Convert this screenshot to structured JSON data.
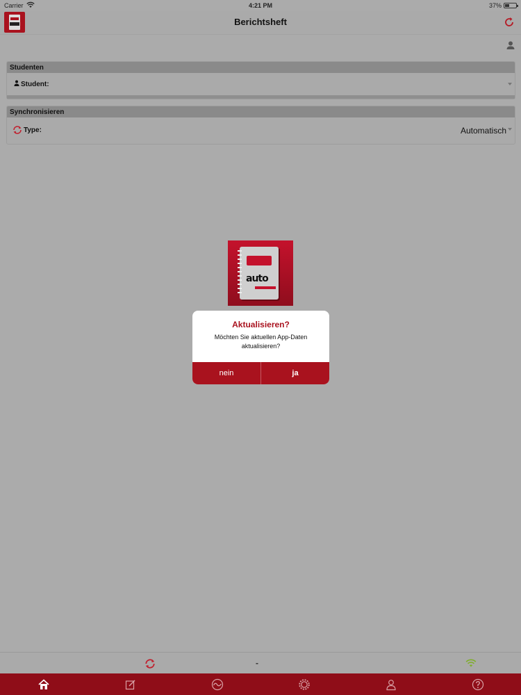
{
  "status_bar": {
    "carrier": "Carrier",
    "time": "4:21 PM",
    "battery": "37%",
    "battery_level": 0.37
  },
  "navbar": {
    "title": "Berichtsheft",
    "logo_icon": "app-logo-icon",
    "refresh_icon": "refresh-icon"
  },
  "user_corner_icon": "user-icon",
  "students_panel": {
    "header": "Studenten",
    "student_label": "Student:",
    "student_value": ""
  },
  "sync_panel": {
    "header": "Synchronisieren",
    "type_label": "Type:",
    "type_value": "Automatisch"
  },
  "app_icon": {
    "word": "auto"
  },
  "dialog": {
    "title": "Aktualisieren?",
    "message": "Möchten Sie aktuellen App-Daten aktualisieren?",
    "no_label": "nein",
    "yes_label": "ja"
  },
  "bottom_status": {
    "status_text": "-",
    "sync_icon": "sync-icon",
    "wifi_icon": "wifi-icon"
  },
  "tabs": [
    {
      "icon": "home-icon",
      "active": true
    },
    {
      "icon": "edit-icon",
      "active": false
    },
    {
      "icon": "chart-icon",
      "active": false
    },
    {
      "icon": "settings-icon",
      "active": false
    },
    {
      "icon": "user-icon",
      "active": false
    },
    {
      "icon": "help-icon",
      "active": false
    }
  ],
  "colors": {
    "accent": "#a9121e",
    "tabbar": "#8f0d18",
    "overlay_bg": "#ababab",
    "sync_icon": "#c0202e",
    "wifi_icon": "#7fae2a"
  }
}
